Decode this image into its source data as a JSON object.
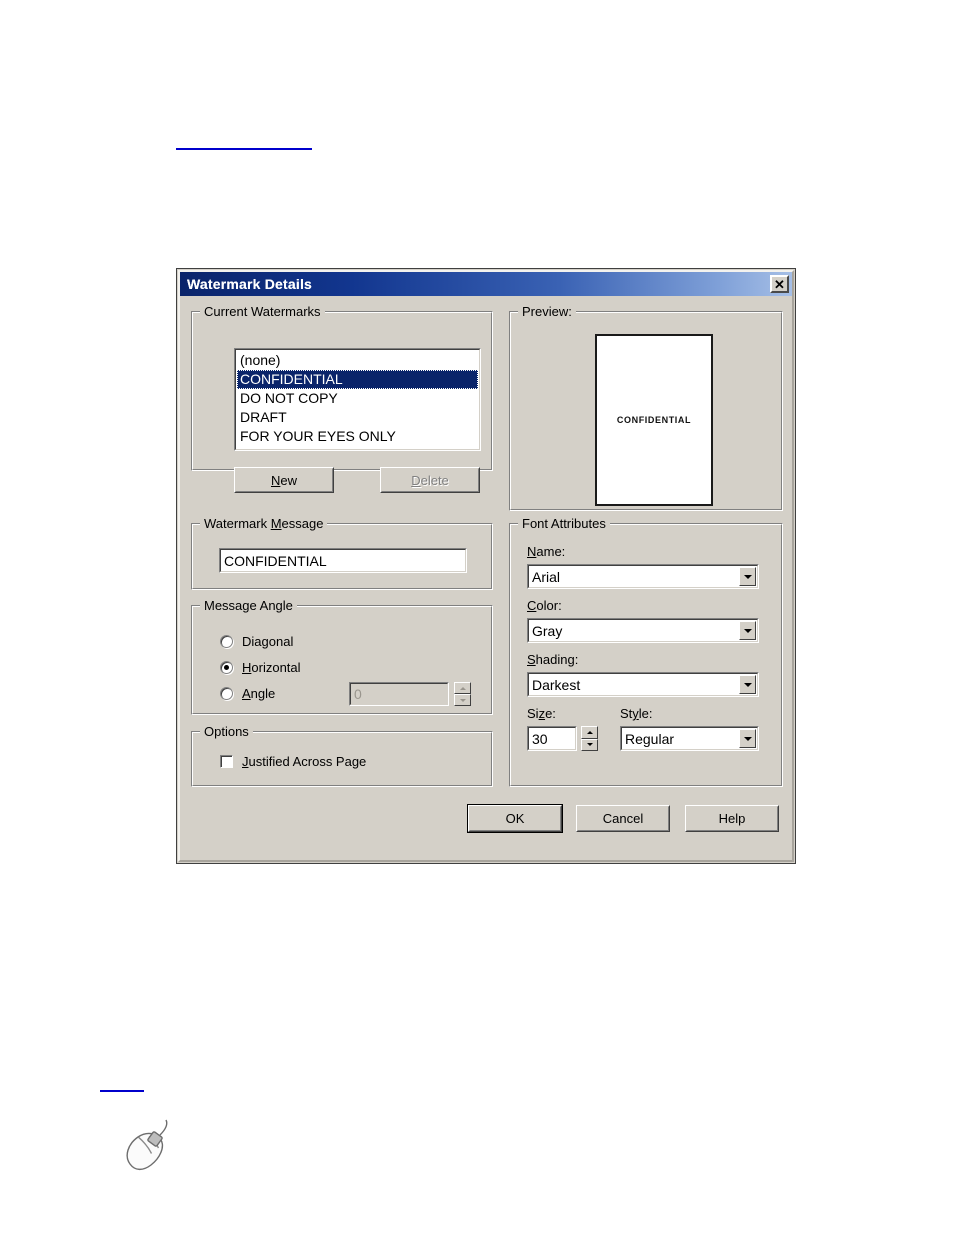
{
  "page": {
    "rule_top": "",
    "rule_bottom": "",
    "mouse_icon": "computer-mouse-illustration"
  },
  "dialog": {
    "title": "Watermark Details",
    "close_label": "✕",
    "close_icon": "close-icon"
  },
  "current_watermarks": {
    "group_title": "Current Watermarks",
    "items": [
      {
        "label": "(none)",
        "selected": false
      },
      {
        "label": "CONFIDENTIAL",
        "selected": true
      },
      {
        "label": "DO NOT COPY",
        "selected": false
      },
      {
        "label": "DRAFT",
        "selected": false
      },
      {
        "label": "FOR YOUR EYES ONLY",
        "selected": false
      }
    ],
    "new_button": {
      "prefix": "",
      "accel": "N",
      "suffix": "ew",
      "enabled": true
    },
    "delete_button": {
      "prefix": "",
      "accel": "D",
      "suffix": "elete",
      "enabled": false
    }
  },
  "preview": {
    "group_title": "Preview:",
    "page_text": "CONFIDENTIAL"
  },
  "watermark_message": {
    "group_title_prefix": "Watermark ",
    "group_title_accel": "M",
    "group_title_suffix": "essage",
    "value": "CONFIDENTIAL",
    "placeholder": ""
  },
  "message_angle": {
    "group_title_prefix": "Messa",
    "group_title_accel": "g",
    "group_title_suffix": "e Angle",
    "options": [
      {
        "prefix": "Dia",
        "accel": "g",
        "suffix": "onal",
        "selected": false
      },
      {
        "prefix": "",
        "accel": "H",
        "suffix": "orizontal",
        "selected": true
      },
      {
        "prefix": "",
        "accel": "A",
        "suffix": "ngle",
        "selected": false
      }
    ],
    "angle_value": "0",
    "angle_enabled": false
  },
  "options": {
    "group_title": "Options",
    "justified": {
      "prefix": "",
      "accel": "J",
      "suffix": "ustified Across Page",
      "checked": false
    }
  },
  "font_attributes": {
    "group_title": "Font Attributes",
    "name": {
      "label_prefix": "",
      "label_accel": "N",
      "label_suffix": "ame:",
      "value": "Arial"
    },
    "color": {
      "label_prefix": "",
      "label_accel": "C",
      "label_suffix": "olor:",
      "value": "Gray"
    },
    "shading": {
      "label_prefix": "",
      "label_accel": "S",
      "label_suffix": "hading:",
      "value": "Darkest"
    },
    "size": {
      "label_prefix": "Si",
      "label_accel": "z",
      "label_suffix": "e:",
      "value": "30"
    },
    "style": {
      "label_prefix": "St",
      "label_accel": "y",
      "label_suffix": "le:",
      "value": "Regular"
    }
  },
  "footer": {
    "ok": "OK",
    "cancel": "Cancel",
    "help": "Help"
  },
  "colors": {
    "dialog_face": "#d4d0c8",
    "caption_start": "#0a246a",
    "caption_end": "#a6bfe6",
    "selection": "#0a246a",
    "link_rule": "#0000cc",
    "disabled_text": "#808080"
  }
}
